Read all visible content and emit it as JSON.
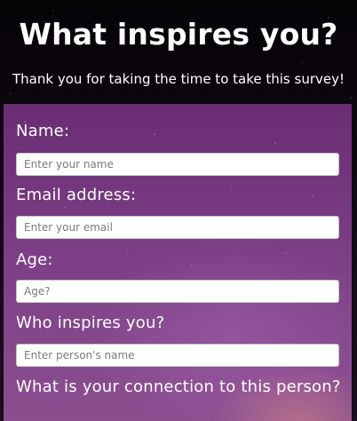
{
  "page": {
    "title": "What inspires you?",
    "subtitle": "Thank you for taking the time to take this survey!"
  },
  "form": {
    "fields": [
      {
        "id": "name",
        "label": "Name:",
        "placeholder": "Enter your name",
        "value": ""
      },
      {
        "id": "email",
        "label": "Email address:",
        "placeholder": "Enter your email",
        "value": ""
      },
      {
        "id": "age",
        "label": "Age:",
        "placeholder": "Age?",
        "value": ""
      },
      {
        "id": "inspirer",
        "label": "Who inspires you?",
        "placeholder": "Enter person's name",
        "value": ""
      },
      {
        "id": "connection",
        "label": "What is your connection to this person?"
      }
    ]
  }
}
